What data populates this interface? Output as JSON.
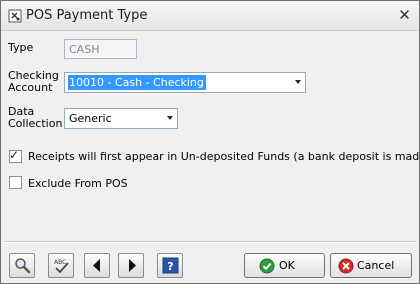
{
  "window": {
    "title": "POS Payment Type",
    "close_glyph": "✕"
  },
  "form": {
    "type_label": "Type",
    "type_value": "CASH",
    "checking_label_line1": "Checking",
    "checking_label_line2": "Account",
    "checking_value": "10010 - Cash - Checking",
    "data_label_line1": "Data",
    "data_label_line2": "Collection",
    "data_value": "Generic",
    "receipts_checked": true,
    "receipts_label": "Receipts will first appear in Un-deposited Funds (a bank deposit is made)",
    "exclude_checked": false,
    "exclude_label": "Exclude From POS"
  },
  "toolbar": {
    "tools": [
      "search-icon",
      "spell-check-icon",
      "previous-icon",
      "next-icon",
      "help-icon"
    ],
    "ok_label": "OK",
    "cancel_label": "Cancel"
  },
  "colors": {
    "selection": "#3399ff",
    "ok_icon": "#2e9e3a",
    "cancel_icon": "#d32b2b",
    "help_icon": "#2a56a8"
  }
}
